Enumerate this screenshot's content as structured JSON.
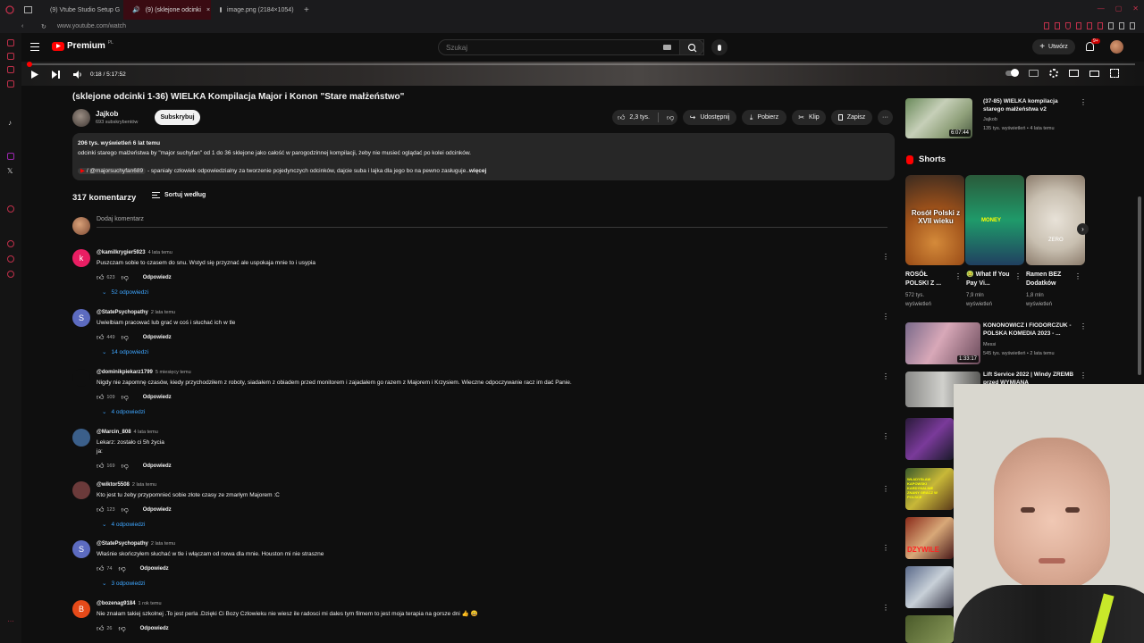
{
  "browser": {
    "tabs": [
      "(9) Vtube Studio Setup G",
      "(9) (sklejone odcinki",
      "image.png (2184×1054)"
    ],
    "url": "www.youtube.com/watch"
  },
  "header": {
    "premium": "Premium",
    "region": "PL",
    "search_placeholder": "Szukaj",
    "create": "Utwórz",
    "notif_count": "9+"
  },
  "player": {
    "time": "0:18 / 5:17:52"
  },
  "video": {
    "title": "(sklejone odcinki 1-36) WIELKA Kompilacja Major i Konon \"Stare małżeństwo\"",
    "channel": "Jajkob",
    "subscribers": "693 subskrybentów",
    "subscribe": "Subskrybuj",
    "likes": "2,3 tys.",
    "share": "Udostępnij",
    "download": "Pobierz",
    "clip": "Klip",
    "save": "Zapisz",
    "desc_stats": "206 tys. wyświetleń  6 lat temu",
    "desc_line1": "odcinki starego małżeństwa by \"major suchyfan\" od 1 do 36 sklejone jako całość w parogodzinnej kompilacji, żeby nie musieć oglądać po kolei odcinków.",
    "desc_handle": "/ @majorsuchyfan689",
    "desc_line2": " - spaniały człowiek odpowiedzialny za tworzenie pojedynczych odcinków, dajcie suba i lajka dla jego bo na pewno zasługuje..",
    "desc_more": "więcej"
  },
  "comments": {
    "count": "317 komentarzy",
    "sort": "Sortuj według",
    "add": "Dodaj komentarz",
    "reply_label": "Odpowiedz",
    "items": [
      {
        "initial": "k",
        "color": "#e91e63",
        "author": "@kamilkrygier5923",
        "time": "4 lata temu",
        "text": "Puszczam sobie to czasem do snu. Wstyd się przyznać ale uspokaja mnie to i usypia",
        "likes": "623",
        "replies": "52 odpowiedzi"
      },
      {
        "initial": "S",
        "color": "#5c6bc0",
        "author": "@StatePsychopathy",
        "time": "2 lata temu",
        "text": "Uwielbiam pracować lub grać w coś i słuchać ich w tle",
        "likes": "449",
        "replies": "14 odpowiedzi"
      },
      {
        "initial": "",
        "color": "#0f0f0f",
        "author": "@dominikpiekarz1799",
        "time": "5 miesięcy temu",
        "text": "Nigdy nie zapomnę czasów, kiedy przychodziłem z roboty, siadałem z obiadem przed monitorem i zajadałem go razem z Majorem i Krzysiem. Wieczne odpoczywanie racz im dać Panie.",
        "likes": "109",
        "replies": "4 odpowiedzi"
      },
      {
        "initial": "",
        "color": "#3b5f8a",
        "author": "@Marcin_808",
        "time": "4 lata temu",
        "text": "Lekarz: zostało ci 5h życia",
        "text2": "ja:",
        "likes": "169",
        "replies": ""
      },
      {
        "initial": "",
        "color": "#6b3a3a",
        "author": "@wiktor5508",
        "time": "2 lata temu",
        "text": "Kto jest tu żeby przypomnieć sobie złote czasy ze zmarłym Majorem :C",
        "likes": "123",
        "replies": "4 odpowiedzi"
      },
      {
        "initial": "S",
        "color": "#5c6bc0",
        "author": "@StatePsychopathy",
        "time": "2 lata temu",
        "text": "Właśnie skończyłem słuchać w tle i włączam od nowa dla mnie. Houston mi nie straszne",
        "likes": "74",
        "replies": "3 odpowiedzi"
      },
      {
        "initial": "B",
        "color": "#e64a19",
        "author": "@bozenag9184",
        "time": "1 rok temu",
        "text": "Nie znałam takiej szkolnej .To jest perla .Dzięki Ci Bozy Czlowieku nie wiesz ile radosci mi dales tym filmem to jest moja terapia na gorsze dni 👍 😀",
        "likes": "26",
        "replies": ""
      }
    ]
  },
  "sidebar": {
    "top_video": {
      "title": "(37-85) WIELKA kompilacja starego małżeństwa v2",
      "channel": "Jajkob",
      "stats": "135 tys. wyświetleń • 4 lata temu",
      "duration": "6:07:44"
    },
    "shorts_title": "Shorts",
    "shorts": [
      {
        "title": "ROSÓŁ POLSKI Z ...",
        "views": "572 tys.",
        "views2": "wyświetleń",
        "overlay": "Rosół Polski z XVII wieku"
      },
      {
        "title": "🤢 What If You Pay Vi...",
        "views": "7,9 mln",
        "views2": "wyświetleń",
        "overlay": "MONEY"
      },
      {
        "title": "Ramen BEZ Dodatków",
        "views": "1,8 mln",
        "views2": "wyświetleń",
        "overlay": "ZERO"
      }
    ],
    "videos": [
      {
        "title": "KONONOWICZ I FIODORCZUK - POLSKA KOMEDIA 2023 - ...",
        "channel": "Messi",
        "stats": "545 tys. wyświetleń • 2 lata temu",
        "duration": "1:33:17"
      },
      {
        "title": "Lift Service 2022 | Windy ZREMB przed WYMIANĄ",
        "channel": "",
        "stats": "",
        "duration": ""
      }
    ],
    "thumb_label_3": "WŁADYSŁAW KAPOWSKI KARDYNALNIE ZNANY GRACZ W POLSCE",
    "thumb_label_4": "DZYWILE"
  },
  "colors": {
    "accent": "#ff0000",
    "link": "#3ea6ff",
    "bg": "#0f0f0f",
    "chip": "#272727"
  }
}
